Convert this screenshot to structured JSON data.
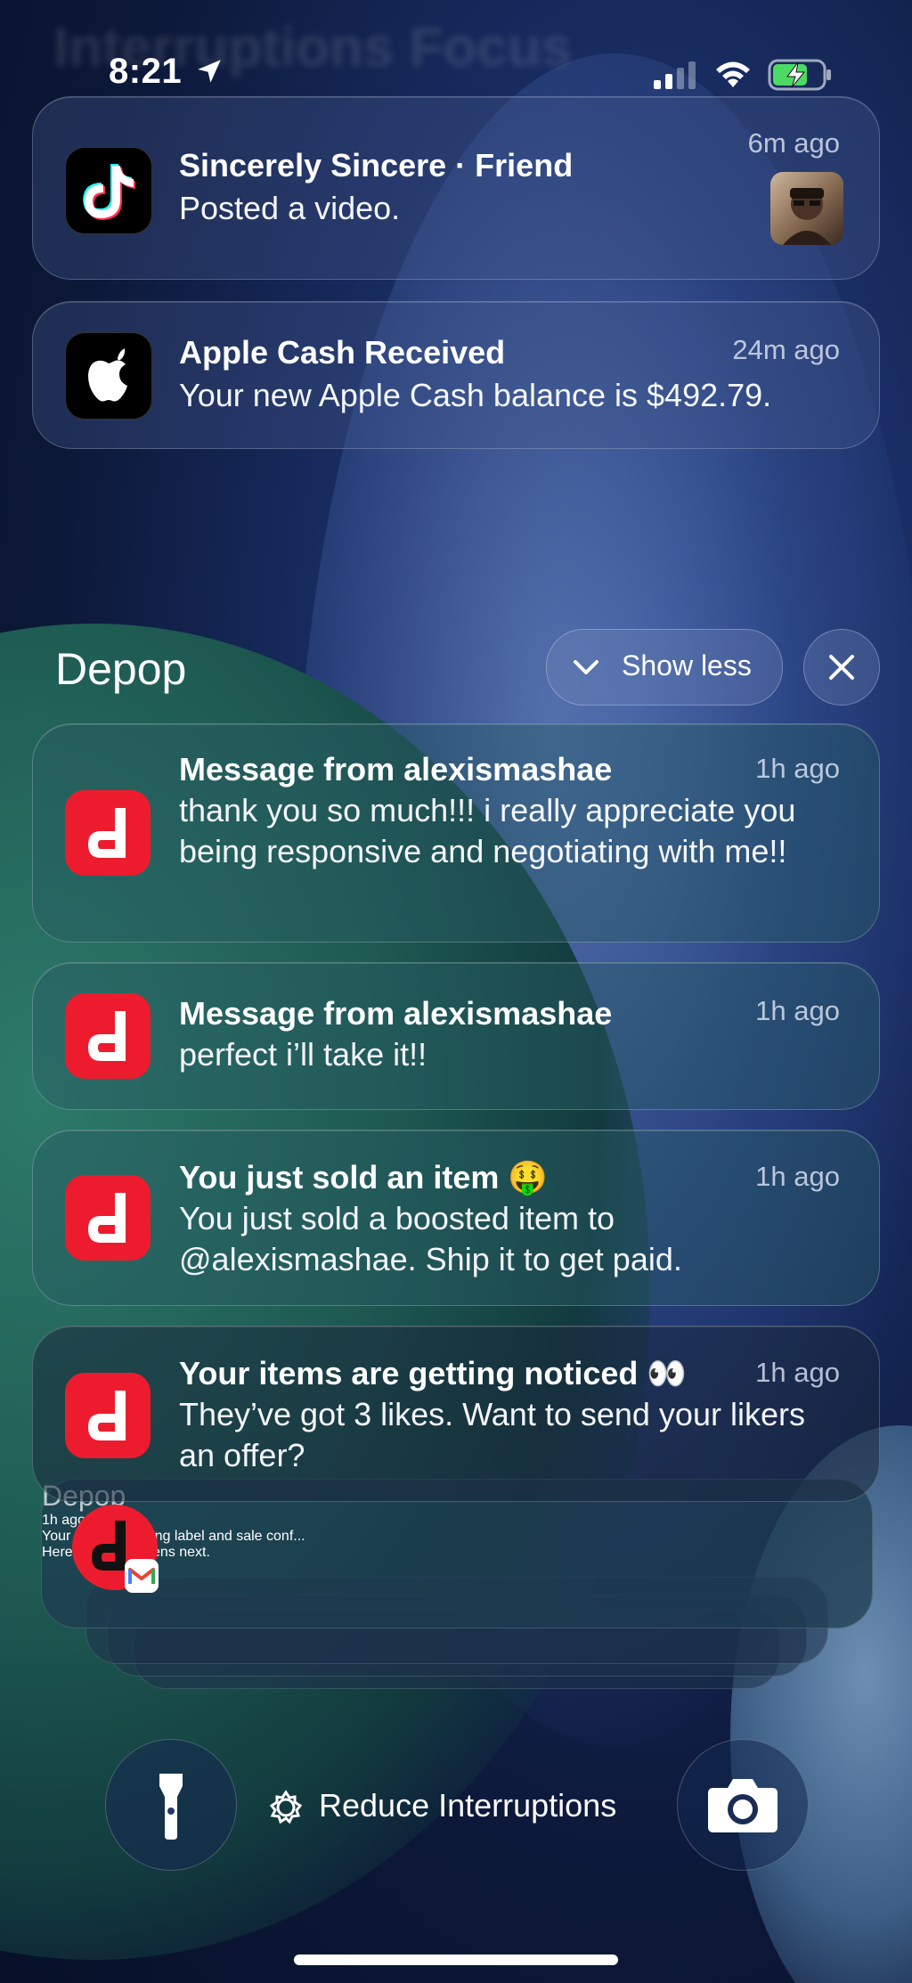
{
  "status_bar": {
    "time": "8:21",
    "icons": [
      "location-arrow-icon",
      "cellular-signal-icon",
      "wifi-icon",
      "battery-charging-icon"
    ]
  },
  "background_banner": "Interruptions Focus",
  "notifications": [
    {
      "app_icon": "tiktok-icon",
      "title": "Sincerely Sincere · Friend",
      "body": "Posted a video.",
      "time": "6m ago"
    },
    {
      "app_icon": "apple-wallet-icon",
      "title": "Apple Cash Received",
      "body": "Your new Apple Cash balance is $492.79.",
      "time": "24m ago"
    }
  ],
  "depop_group": {
    "title": "Depop",
    "show_less_label": "Show less",
    "items": [
      {
        "title": "Message from alexismashae",
        "body": "thank you so much!!! i really appreciate you being responsive and negotiating with me!!",
        "time": "1h ago"
      },
      {
        "title": "Message from alexismashae",
        "body": "perfect i’ll take it!!",
        "time": "1h ago"
      },
      {
        "title": "You just sold an item 🤑",
        "body": "You just sold a boosted item to @alexismashae. Ship it to get paid.",
        "time": "1h ago"
      },
      {
        "title": "Your items are getting noticed 👀",
        "body": "They’ve got 3 likes. Want to send your likers an offer?",
        "time": "1h ago"
      }
    ]
  },
  "stacked_notification": {
    "app": "Depop",
    "title": "Your USPS shipping label and sale conf...",
    "body": "Here's what happens next.",
    "time": "1h ago"
  },
  "bottom": {
    "focus_label": "Reduce Interruptions"
  },
  "colors": {
    "depop_red": "#ec1c2e",
    "card_tint": "#465a8c"
  }
}
